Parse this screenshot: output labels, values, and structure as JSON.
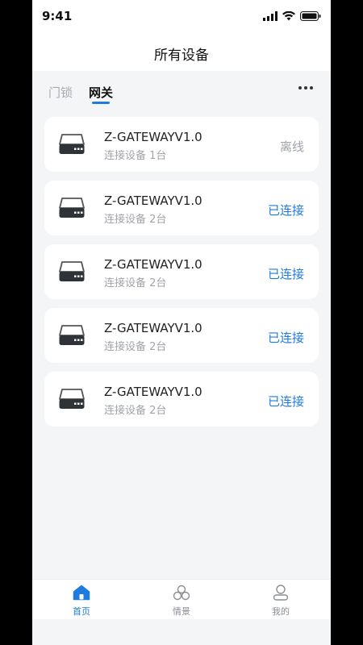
{
  "status_bar": {
    "time": "9:41"
  },
  "header": {
    "title": "所有设备"
  },
  "tabs": [
    {
      "label": "门锁",
      "active": false
    },
    {
      "label": "网关",
      "active": true
    }
  ],
  "colors": {
    "accent": "#1f7be0",
    "muted": "#a0a4ab",
    "background": "#f4f5f7"
  },
  "devices": [
    {
      "name": "Z-GATEWAYV1.0",
      "subtitle": "连接设备  1台",
      "status": "离线",
      "state": "offline"
    },
    {
      "name": "Z-GATEWAYV1.0",
      "subtitle": "连接设备  2台",
      "status": "已连接",
      "state": "online"
    },
    {
      "name": "Z-GATEWAYV1.0",
      "subtitle": "连接设备  2台",
      "status": "已连接",
      "state": "online"
    },
    {
      "name": "Z-GATEWAYV1.0",
      "subtitle": "连接设备  2台",
      "status": "已连接",
      "state": "online"
    },
    {
      "name": "Z-GATEWAYV1.0",
      "subtitle": "连接设备  2台",
      "status": "已连接",
      "state": "online"
    }
  ],
  "tabbar": [
    {
      "label": "首页",
      "icon": "home-icon",
      "active": true
    },
    {
      "label": "情景",
      "icon": "scene-icon",
      "active": false
    },
    {
      "label": "我的",
      "icon": "user-icon",
      "active": false
    }
  ]
}
